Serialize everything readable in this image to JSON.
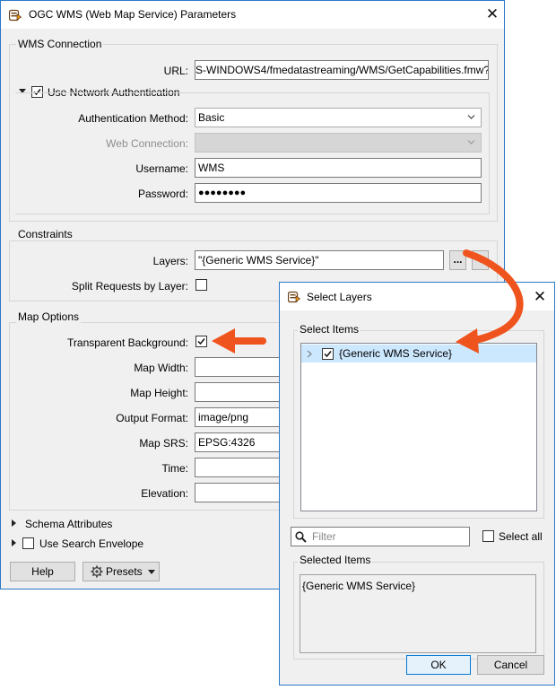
{
  "main": {
    "title": "OGC WMS (Web Map Service) Parameters",
    "wms_connection": {
      "group_label": "WMS Connection",
      "url_label": "URL:",
      "url_value": "S-WINDOWS4/fmedatastreaming/WMS/GetCapabilities.fmw?",
      "network_auth_label": "Use Network Authentication",
      "auth_method_label": "Authentication Method:",
      "auth_method_value": "Basic",
      "web_connection_label": "Web Connection:",
      "web_connection_value": "",
      "username_label": "Username:",
      "username_value": "WMS",
      "password_label": "Password:",
      "password_value": "●●●●●●●●"
    },
    "constraints": {
      "group_label": "Constraints",
      "layers_label": "Layers:",
      "layers_value": "\"{Generic WMS Service}\"",
      "ellipsis_label": "...",
      "split_label": "Split Requests by Layer:"
    },
    "map_options": {
      "group_label": "Map Options",
      "transparent_label": "Transparent Background:",
      "width_label": "Map Width:",
      "width_value": "",
      "height_label": "Map Height:",
      "height_value": "",
      "format_label": "Output Format:",
      "format_value": "image/png",
      "srs_label": "Map SRS:",
      "srs_value": "EPSG:4326",
      "time_label": "Time:",
      "time_value": "",
      "elevation_label": "Elevation:",
      "elevation_value": ""
    },
    "schema_attributes_label": "Schema Attributes",
    "search_envelope_label": "Use Search Envelope",
    "help_label": "Help",
    "presets_label": "Presets"
  },
  "select_layers": {
    "title": "Select Layers",
    "select_items_label": "Select Items",
    "tree_item": "{Generic WMS Service}",
    "filter_placeholder": "Filter",
    "select_all_label": "Select all",
    "selected_items_label": "Selected Items",
    "selected_value": "{Generic WMS Service}",
    "ok_label": "OK",
    "cancel_label": "Cancel"
  },
  "colors": {
    "accent": "#0078d7",
    "window_border": "#2b79c7",
    "annotation_arrow": "#f0541e",
    "selection": "#cce8ff"
  },
  "icons": [
    "fme-app-icon",
    "close-icon",
    "checkbox-check-icon",
    "search-icon",
    "gear-icon",
    "chevron-down-icon",
    "annotation-arrow-icon"
  ]
}
